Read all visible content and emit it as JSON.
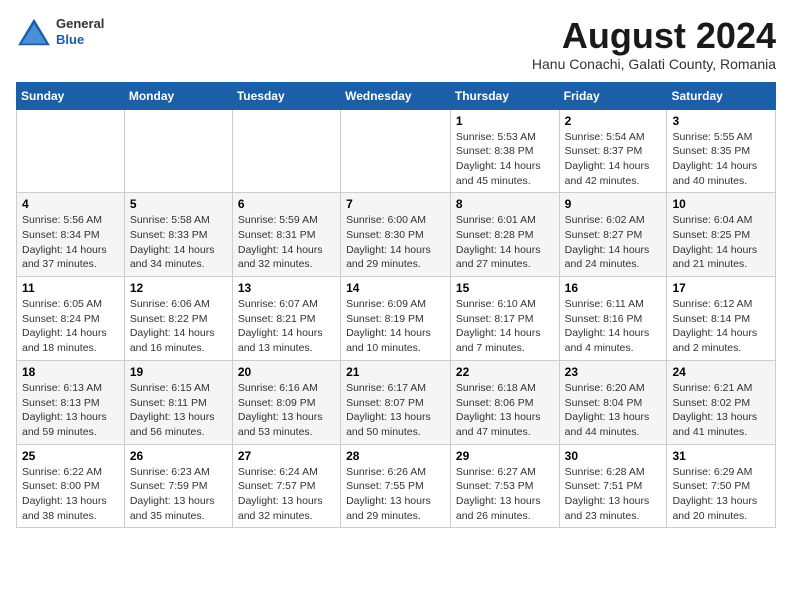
{
  "header": {
    "logo_line1": "General",
    "logo_line2": "Blue",
    "month_title": "August 2024",
    "subtitle": "Hanu Conachi, Galati County, Romania"
  },
  "days_of_week": [
    "Sunday",
    "Monday",
    "Tuesday",
    "Wednesday",
    "Thursday",
    "Friday",
    "Saturday"
  ],
  "weeks": [
    [
      {
        "day": "",
        "info": ""
      },
      {
        "day": "",
        "info": ""
      },
      {
        "day": "",
        "info": ""
      },
      {
        "day": "",
        "info": ""
      },
      {
        "day": "1",
        "info": "Sunrise: 5:53 AM\nSunset: 8:38 PM\nDaylight: 14 hours and 45 minutes."
      },
      {
        "day": "2",
        "info": "Sunrise: 5:54 AM\nSunset: 8:37 PM\nDaylight: 14 hours and 42 minutes."
      },
      {
        "day": "3",
        "info": "Sunrise: 5:55 AM\nSunset: 8:35 PM\nDaylight: 14 hours and 40 minutes."
      }
    ],
    [
      {
        "day": "4",
        "info": "Sunrise: 5:56 AM\nSunset: 8:34 PM\nDaylight: 14 hours and 37 minutes."
      },
      {
        "day": "5",
        "info": "Sunrise: 5:58 AM\nSunset: 8:33 PM\nDaylight: 14 hours and 34 minutes."
      },
      {
        "day": "6",
        "info": "Sunrise: 5:59 AM\nSunset: 8:31 PM\nDaylight: 14 hours and 32 minutes."
      },
      {
        "day": "7",
        "info": "Sunrise: 6:00 AM\nSunset: 8:30 PM\nDaylight: 14 hours and 29 minutes."
      },
      {
        "day": "8",
        "info": "Sunrise: 6:01 AM\nSunset: 8:28 PM\nDaylight: 14 hours and 27 minutes."
      },
      {
        "day": "9",
        "info": "Sunrise: 6:02 AM\nSunset: 8:27 PM\nDaylight: 14 hours and 24 minutes."
      },
      {
        "day": "10",
        "info": "Sunrise: 6:04 AM\nSunset: 8:25 PM\nDaylight: 14 hours and 21 minutes."
      }
    ],
    [
      {
        "day": "11",
        "info": "Sunrise: 6:05 AM\nSunset: 8:24 PM\nDaylight: 14 hours and 18 minutes."
      },
      {
        "day": "12",
        "info": "Sunrise: 6:06 AM\nSunset: 8:22 PM\nDaylight: 14 hours and 16 minutes."
      },
      {
        "day": "13",
        "info": "Sunrise: 6:07 AM\nSunset: 8:21 PM\nDaylight: 14 hours and 13 minutes."
      },
      {
        "day": "14",
        "info": "Sunrise: 6:09 AM\nSunset: 8:19 PM\nDaylight: 14 hours and 10 minutes."
      },
      {
        "day": "15",
        "info": "Sunrise: 6:10 AM\nSunset: 8:17 PM\nDaylight: 14 hours and 7 minutes."
      },
      {
        "day": "16",
        "info": "Sunrise: 6:11 AM\nSunset: 8:16 PM\nDaylight: 14 hours and 4 minutes."
      },
      {
        "day": "17",
        "info": "Sunrise: 6:12 AM\nSunset: 8:14 PM\nDaylight: 14 hours and 2 minutes."
      }
    ],
    [
      {
        "day": "18",
        "info": "Sunrise: 6:13 AM\nSunset: 8:13 PM\nDaylight: 13 hours and 59 minutes."
      },
      {
        "day": "19",
        "info": "Sunrise: 6:15 AM\nSunset: 8:11 PM\nDaylight: 13 hours and 56 minutes."
      },
      {
        "day": "20",
        "info": "Sunrise: 6:16 AM\nSunset: 8:09 PM\nDaylight: 13 hours and 53 minutes."
      },
      {
        "day": "21",
        "info": "Sunrise: 6:17 AM\nSunset: 8:07 PM\nDaylight: 13 hours and 50 minutes."
      },
      {
        "day": "22",
        "info": "Sunrise: 6:18 AM\nSunset: 8:06 PM\nDaylight: 13 hours and 47 minutes."
      },
      {
        "day": "23",
        "info": "Sunrise: 6:20 AM\nSunset: 8:04 PM\nDaylight: 13 hours and 44 minutes."
      },
      {
        "day": "24",
        "info": "Sunrise: 6:21 AM\nSunset: 8:02 PM\nDaylight: 13 hours and 41 minutes."
      }
    ],
    [
      {
        "day": "25",
        "info": "Sunrise: 6:22 AM\nSunset: 8:00 PM\nDaylight: 13 hours and 38 minutes."
      },
      {
        "day": "26",
        "info": "Sunrise: 6:23 AM\nSunset: 7:59 PM\nDaylight: 13 hours and 35 minutes."
      },
      {
        "day": "27",
        "info": "Sunrise: 6:24 AM\nSunset: 7:57 PM\nDaylight: 13 hours and 32 minutes."
      },
      {
        "day": "28",
        "info": "Sunrise: 6:26 AM\nSunset: 7:55 PM\nDaylight: 13 hours and 29 minutes."
      },
      {
        "day": "29",
        "info": "Sunrise: 6:27 AM\nSunset: 7:53 PM\nDaylight: 13 hours and 26 minutes."
      },
      {
        "day": "30",
        "info": "Sunrise: 6:28 AM\nSunset: 7:51 PM\nDaylight: 13 hours and 23 minutes."
      },
      {
        "day": "31",
        "info": "Sunrise: 6:29 AM\nSunset: 7:50 PM\nDaylight: 13 hours and 20 minutes."
      }
    ]
  ]
}
